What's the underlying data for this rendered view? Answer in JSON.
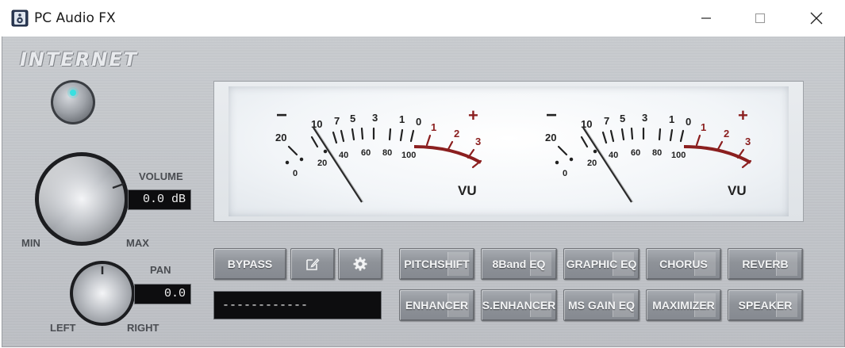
{
  "window": {
    "title": "PC Audio FX",
    "controls": [
      "minimize",
      "maximize",
      "close"
    ]
  },
  "brand": "INTERNET",
  "volume": {
    "label": "VOLUME",
    "value": "0.0 dB",
    "min_label": "MIN",
    "max_label": "MAX"
  },
  "pan": {
    "label": "PAN",
    "value": "0.0",
    "left_label": "LEFT",
    "right_label": "RIGHT"
  },
  "vu_meters": [
    {
      "minus": "−",
      "plus": "+",
      "unit": "VU",
      "scale_top": [
        "20",
        "10",
        "7",
        "5",
        "3",
        "1",
        "0",
        "1",
        "2",
        "3"
      ],
      "scale_bottom": [
        "0",
        "20",
        "40",
        "60",
        "80",
        "100"
      ]
    },
    {
      "minus": "−",
      "plus": "+",
      "unit": "VU",
      "scale_top": [
        "20",
        "10",
        "7",
        "5",
        "3",
        "1",
        "0",
        "1",
        "2",
        "3"
      ],
      "scale_bottom": [
        "0",
        "20",
        "40",
        "60",
        "80",
        "100"
      ]
    }
  ],
  "controls": {
    "bypass": "BYPASS",
    "edit_icon": "edit-icon",
    "settings_icon": "gear-icon",
    "preset_display": "------------"
  },
  "effects_row1": [
    "PITCHSHIFT",
    "8Band EQ",
    "GRAPHIC EQ",
    "CHORUS",
    "REVERB"
  ],
  "effects_row2": [
    "ENHANCER",
    "S.ENHANCER",
    "MS GAIN EQ",
    "MAXIMIZER",
    "SPEAKER"
  ],
  "colors": {
    "red_zone": "#8b1f1f",
    "display_bg": "#0d0d0f",
    "led": "#39e0e0"
  }
}
